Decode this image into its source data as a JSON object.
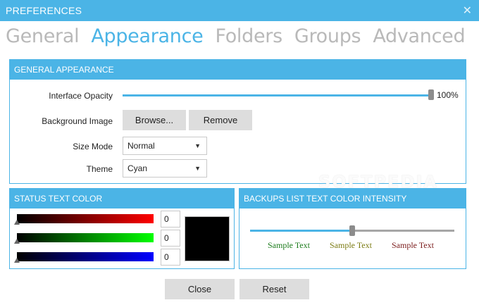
{
  "window": {
    "title": "PREFERENCES"
  },
  "tabs": [
    {
      "label": "General",
      "active": false
    },
    {
      "label": "Appearance",
      "active": true
    },
    {
      "label": "Folders",
      "active": false
    },
    {
      "label": "Groups",
      "active": false
    },
    {
      "label": "Advanced",
      "active": false
    }
  ],
  "general_appearance": {
    "header": "GENERAL APPEARANCE",
    "opacity_label": "Interface Opacity",
    "opacity_value": "100%",
    "opacity_fraction": 1.0,
    "background_label": "Background Image",
    "browse_label": "Browse...",
    "remove_label": "Remove",
    "size_mode_label": "Size Mode",
    "size_mode_value": "Normal",
    "theme_label": "Theme",
    "theme_value": "Cyan"
  },
  "status_text_color": {
    "header": "STATUS TEXT COLOR",
    "red": "0",
    "green": "0",
    "blue": "0",
    "preview_color": "#000000"
  },
  "backups_list": {
    "header": "BACKUPS LIST TEXT COLOR INTENSITY",
    "intensity_fraction": 0.5,
    "samples": [
      {
        "text": "Sample Text",
        "color": "#1a7a1a"
      },
      {
        "text": "Sample Text",
        "color": "#7a7a10"
      },
      {
        "text": "Sample Text",
        "color": "#7a1a1a"
      }
    ]
  },
  "footer": {
    "close_label": "Close",
    "reset_label": "Reset"
  },
  "watermark": "SOFTPEDIA",
  "colors": {
    "accent": "#4bb4e6",
    "button": "#dddddd"
  }
}
